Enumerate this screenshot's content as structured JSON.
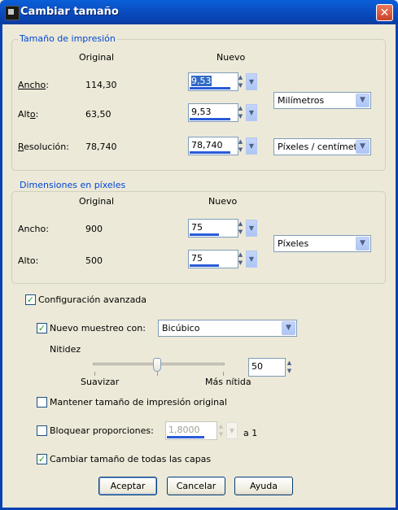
{
  "window": {
    "title": "Cambiar tamaño",
    "icon": "app-icon",
    "close_glyph": "✕"
  },
  "print_size": {
    "group_title": "Tamaño de impresión",
    "col_original": "Original",
    "col_new": "Nuevo",
    "width": {
      "label_pre": "Ancho",
      "label_post": ":",
      "original": "114,30",
      "new": "9,53"
    },
    "height": {
      "label_pre": "Alt",
      "label_u": "o",
      "label_post": ":",
      "original": "63,50",
      "new": "9,53"
    },
    "resolution": {
      "label_u": "R",
      "label_post": "esolución:",
      "original": "78,740",
      "new": "78,740"
    },
    "units_selected": "Milímetros",
    "resolution_units_selected": "Píxeles / centímetro"
  },
  "pixel_dims": {
    "group_title": "Dimensiones en píxeles",
    "col_original": "Original",
    "col_new": "Nuevo",
    "width": {
      "label": "Ancho:",
      "original": "900",
      "new": "75"
    },
    "height": {
      "label": "Alto:",
      "original": "500",
      "new": "75"
    },
    "units_selected": "Píxeles"
  },
  "advanced": {
    "label": "Configuración avanzada",
    "checked": true,
    "resample_label": "Nuevo muestreo con:",
    "resample_checked": true,
    "resample_method": "Bicúbico",
    "sharpness_label": "Nitidez",
    "sharpness_value": "50",
    "slider_min_label": "Suavizar",
    "slider_max_label": "Más nítida",
    "slider_position": 0.5,
    "keep_print_size_label": "Mantener tamaño de impresión original",
    "keep_print_size_checked": false,
    "lock_ratio_label": "Bloquear proporciones:",
    "lock_ratio_checked": false,
    "lock_ratio_value": "1,8000",
    "lock_ratio_suffix": "a 1",
    "resize_all_layers_label": "Cambiar tamaño de todas las capas",
    "resize_all_layers_checked": true
  },
  "buttons": {
    "ok": "Aceptar",
    "cancel": "Cancelar",
    "help": "Ayuda"
  },
  "colors": {
    "titlebar": "#0a4fc4",
    "group_title": "#0046d5",
    "check": "#21a121",
    "dialog_bg": "#ece9d8"
  }
}
